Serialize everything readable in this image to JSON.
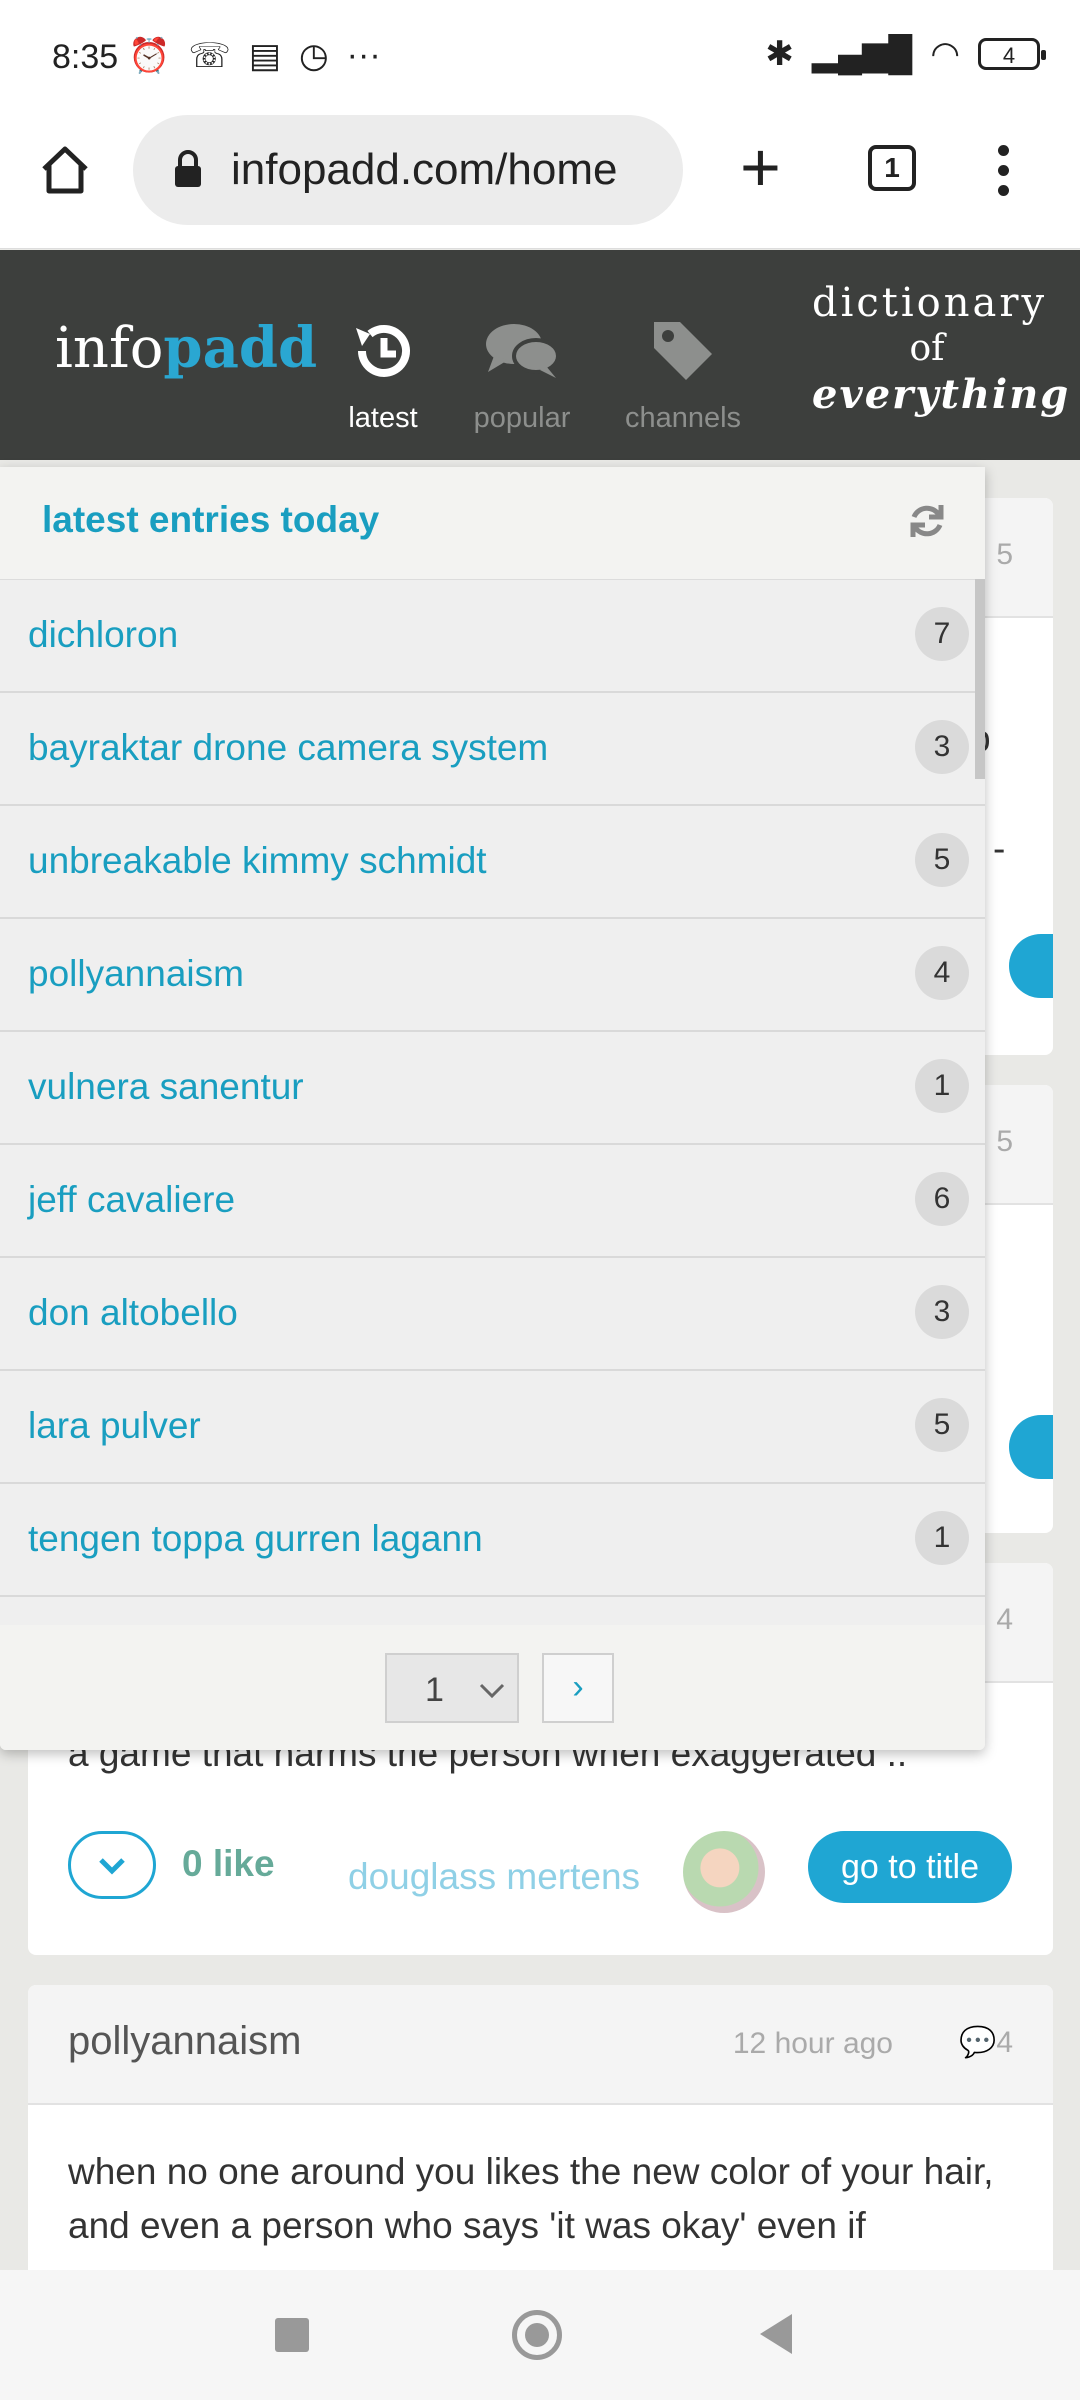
{
  "status_bar": {
    "time": "8:35",
    "battery": "4"
  },
  "browser": {
    "url": "infopadd.com/home",
    "tab_count": "1"
  },
  "site": {
    "logo_part1": "info",
    "logo_part2": "padd",
    "tabs": [
      {
        "label": "latest",
        "icon": "history-icon",
        "active": true
      },
      {
        "label": "popular",
        "icon": "chat-bubbles-icon",
        "active": false
      },
      {
        "label": "channels",
        "icon": "tag-icon",
        "active": false
      }
    ],
    "tagline": {
      "line1": "dictionary",
      "line2": "of",
      "line3": "everything"
    }
  },
  "panel": {
    "title": "latest entries today",
    "entries": [
      {
        "name": "dichloron",
        "count": "7"
      },
      {
        "name": "bayraktar drone camera system",
        "count": "3"
      },
      {
        "name": "unbreakable kimmy schmidt",
        "count": "5"
      },
      {
        "name": "pollyannaism",
        "count": "4"
      },
      {
        "name": "vulnera sanentur",
        "count": "1"
      },
      {
        "name": "jeff cavaliere",
        "count": "6"
      },
      {
        "name": "don altobello",
        "count": "3"
      },
      {
        "name": "lara pulver",
        "count": "5"
      },
      {
        "name": "tengen toppa gurren lagann",
        "count": "1"
      }
    ],
    "page": "1",
    "next": "›"
  },
  "cards": {
    "card1": {
      "comments": "5",
      "peek1": "p",
      "peek2": "-"
    },
    "card2": {
      "comments": "5"
    },
    "card3": {
      "comments": "4",
      "body": "a game that harms the person when exaggerated ..",
      "likes": "0 like",
      "author": "douglass mertens",
      "go_to_title": "go to title"
    },
    "card4": {
      "title": "pollyannaism",
      "time": "12 hour ago",
      "comments": "4",
      "body": "when no one around you likes the new color of your hair, and even a person who says 'it was okay' even if"
    }
  }
}
